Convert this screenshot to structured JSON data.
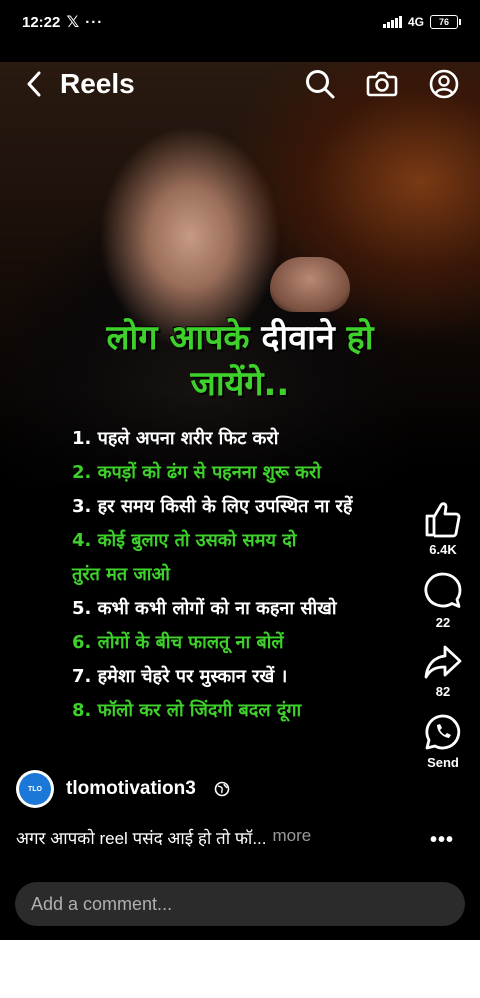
{
  "status": {
    "time": "12:22",
    "x_icon": "x-logo-icon",
    "dots": "···",
    "network": "4G",
    "battery": "76"
  },
  "header": {
    "title": "Reels",
    "icons": [
      "back-icon",
      "search-icon",
      "camera-icon",
      "profile-icon"
    ]
  },
  "post": {
    "headline_part1": "लोग आपके",
    "headline_part2": "दीवाने",
    "headline_part3": "हो",
    "headline_line2": "जायेंगे..",
    "list": [
      {
        "text": "1. पहले अपना शरीर फिट करो",
        "color": "white"
      },
      {
        "text": "2. कपड़ों को ढंग से पहनना शुरू करो",
        "color": "green"
      },
      {
        "text": "3. हर समय किसी के लिए उपस्थित ना रहें",
        "color": "white"
      },
      {
        "text": "4. कोई बुलाए तो उसको समय दो",
        "color": "green"
      },
      {
        "text": "तुरंत मत जाओ",
        "color": "green"
      },
      {
        "text": "5. कभी कभी लोगों को ना कहना सीखो",
        "color": "white"
      },
      {
        "text": "6. लोगों के बीच फालतू ना बोलें",
        "color": "green"
      },
      {
        "text": "7. हमेशा चेहरे पर मुस्कान रखें ।",
        "color": "white"
      },
      {
        "text": "8. फॉलो कर लो जिंदगी बदल दूंगा",
        "color": "green"
      }
    ]
  },
  "actions": {
    "like_count": "6.4K",
    "comment_count": "22",
    "share_count": "82",
    "send_label": "Send"
  },
  "author": {
    "avatar_text": "TLO",
    "username": "tlomotivation3"
  },
  "caption": {
    "text": "अगर आपको reel पसंद आई हो तो फॉ...",
    "more": "more",
    "options": "•••"
  },
  "comment": {
    "placeholder": "Add a comment..."
  },
  "colors": {
    "accent_green": "#3ed12b",
    "background": "#000000",
    "comment_bg": "#2b2b2b"
  }
}
